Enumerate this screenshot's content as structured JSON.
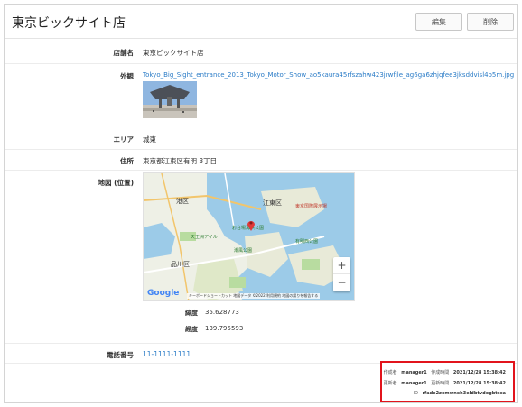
{
  "header": {
    "title": "東京ビックサイト店",
    "edit_label": "編集",
    "delete_label": "削除"
  },
  "fields": {
    "store_name": {
      "label": "店舗名",
      "value": "東京ビックサイト店"
    },
    "exterior": {
      "label": "外観",
      "file_link": "Tokyo_Big_Sight_entrance_2013_Tokyo_Motor_Show_ao5kaura45rfszahw423jrwfjle_ag6ga6zhjqfee3jksddvisl4o5m.jpg"
    },
    "area": {
      "label": "エリア",
      "value": "城東"
    },
    "address": {
      "label": "住所",
      "value": "東京都江東区有明 3丁目"
    },
    "map": {
      "label": "地図 (位置)",
      "place_labels": [
        "港区",
        "江東区",
        "東京国際展示場",
        "品川区",
        "天王洲アイル",
        "有明西公園",
        "潮風公園",
        "お台場海浜公園"
      ],
      "attribution": "キーボードショートカット  地図データ ©2022  利用規約  地図の誤りを報告する",
      "google_text": "Google",
      "zoom_in": "+",
      "zoom_out": "−",
      "latitude_label": "緯度",
      "latitude": "35.628773",
      "longitude_label": "経度",
      "longitude": "139.795593"
    },
    "phone": {
      "label": "電話番号",
      "value": "11-1111-1111"
    }
  },
  "meta": {
    "created_by_label": "作成者",
    "created_by": "manager1",
    "created_at_label": "作成時間",
    "created_at": "2021/12/28 15:38:42",
    "updated_by_label": "更新者",
    "updated_by": "manager1",
    "updated_at_label": "更新時間",
    "updated_at": "2021/12/28 15:38:42",
    "id_label": "ID",
    "id": "rfade2zomwneh3eldbtvdogbtsca"
  },
  "colors": {
    "accent": "#2b7cc7",
    "highlight_border": "#e2141c",
    "map_water": "#9ccbe8",
    "map_land": "#eef0e6",
    "marker": "#e03a3a"
  }
}
